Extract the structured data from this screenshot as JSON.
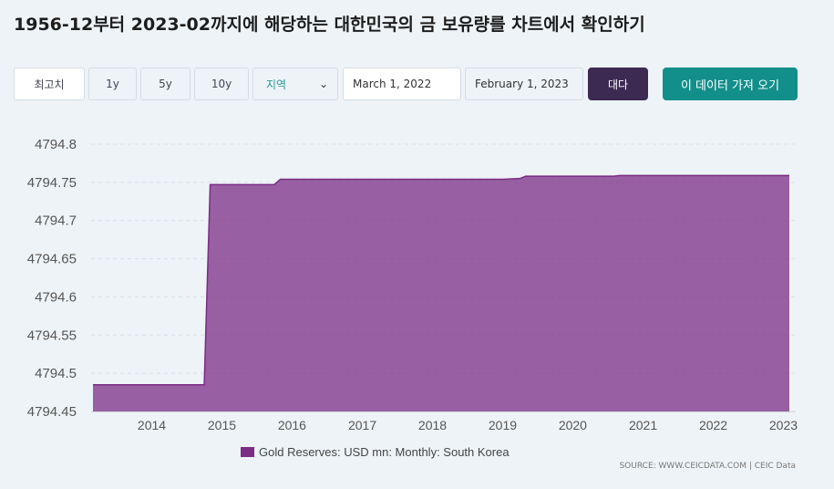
{
  "title": "1956-12부터 2023-02까지에 해당하는 대한민국의 금 보유량를 차트에서 확인하기",
  "toolbar": {
    "range_max_label": "최고치",
    "range_1y_label": "1y",
    "range_5y_label": "5y",
    "range_10y_label": "10y",
    "region_select_value": "지역",
    "start_date": "March 1, 2022",
    "end_date": "February 1, 2023",
    "apply_label": "대다",
    "get_data_label": "이 데이터 가져 오기"
  },
  "colors": {
    "series": "#7b2d86",
    "series_fill": "#7b2d86",
    "accent_dark": "#3d2a52",
    "accent_teal": "#128f8b",
    "background": "#eef3f7"
  },
  "chart_data": {
    "type": "area",
    "y_ticks": [
      "4794.45",
      "4794.5",
      "4794.55",
      "4794.6",
      "4794.65",
      "4794.7",
      "4794.75",
      "4794.8"
    ],
    "x_ticks": [
      "2014",
      "2015",
      "2016",
      "2017",
      "2018",
      "2019",
      "2020",
      "2021",
      "2022",
      "2023"
    ],
    "ylim": [
      4794.45,
      4794.8
    ],
    "xlim": [
      "2013-03",
      "2023-02"
    ],
    "grid": true,
    "legend_position": "bottom",
    "series": [
      {
        "name": "Gold Reserves: USD mn: Monthly: South Korea",
        "points": [
          [
            "2013-03",
            4794.485
          ],
          [
            "2014-10",
            4794.485
          ],
          [
            "2014-11",
            4794.747
          ],
          [
            "2015-10",
            4794.747
          ],
          [
            "2015-11",
            4794.754
          ],
          [
            "2019-01",
            4794.754
          ],
          [
            "2019-04",
            4794.755
          ],
          [
            "2019-05",
            4794.758
          ],
          [
            "2020-08",
            4794.758
          ],
          [
            "2020-09",
            4794.759
          ],
          [
            "2023-02",
            4794.759
          ]
        ]
      }
    ],
    "source": "SOURCE: WWW.CEICDATA.COM | CEIC Data"
  }
}
